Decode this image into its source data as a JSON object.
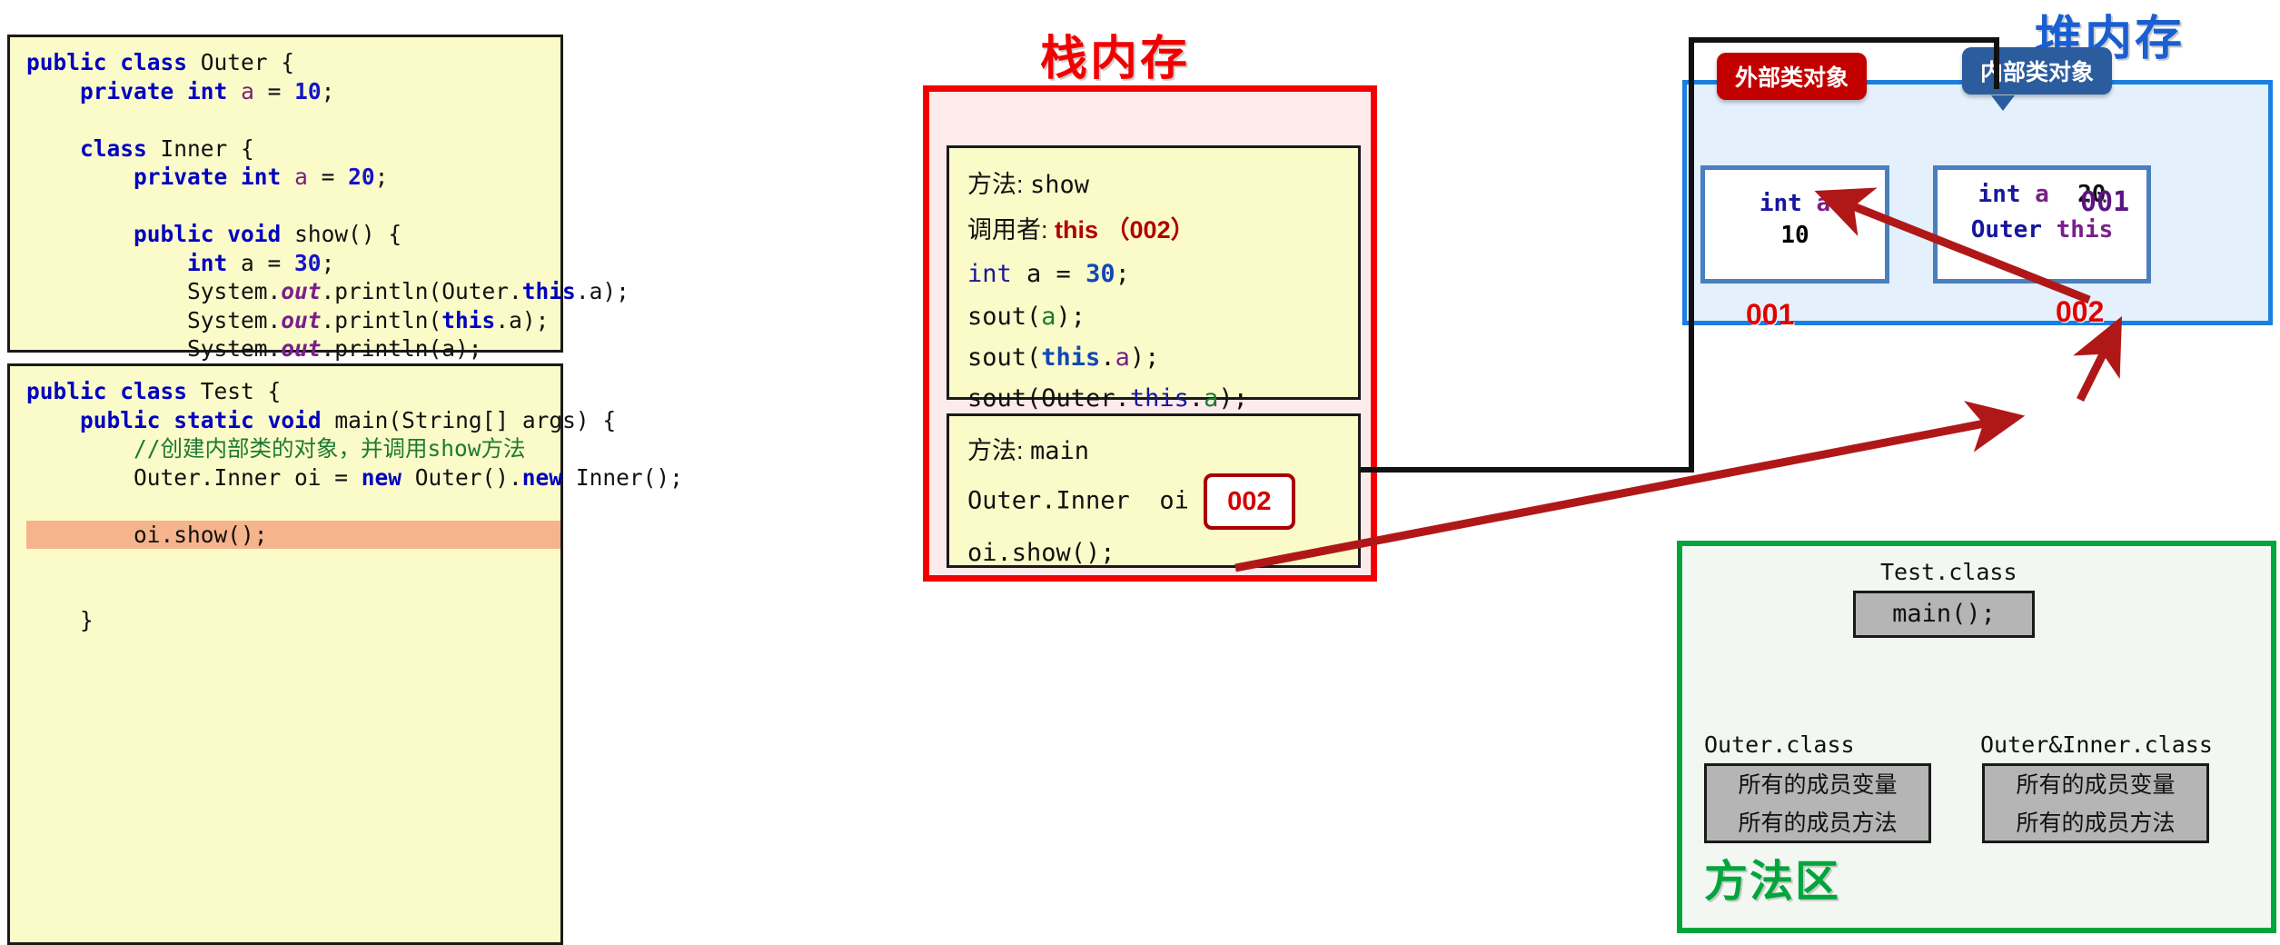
{
  "titles": {
    "stack": "栈内存",
    "heap": "堆内存",
    "method_area": "方法区"
  },
  "code_outer": {
    "lines": [
      "public class Outer {",
      "    private int a = 10;",
      "",
      "    class Inner {",
      "        private int a = 20;",
      "",
      "        public void show() {",
      "            int a = 30;",
      "            System.out.println(Outer.this.a);",
      "            System.out.println(this.a);",
      "            System.out.println(a);",
      "        }",
      "    }",
      "}"
    ]
  },
  "code_test": {
    "lines": [
      "public class Test {",
      "    public static void main(String[] args) {",
      "        //创建内部类的对象，并调用show方法",
      "        Outer.Inner oi = new Outer().new Inner();",
      "",
      "        oi.show();",
      "",
      "",
      "    }"
    ],
    "highlighted_line": "        oi.show();"
  },
  "stack": {
    "frame_show": {
      "method_label": "方法:",
      "method_name": "show",
      "caller_label": "调用者:",
      "caller_value": "this （002）",
      "lines": [
        "int a = 30;",
        "sout(a);",
        "sout(this.a);",
        "sout(Outer.this.a);"
      ]
    },
    "frame_main": {
      "method_label": "方法:",
      "method_name": "main",
      "var_decl": "Outer.Inner  oi",
      "var_value": "002",
      "call_line": "oi.show();"
    }
  },
  "heap": {
    "outer_object": {
      "tag": "外部类对象",
      "field_type": "int",
      "field_name": "a",
      "field_value": "10",
      "address": "001"
    },
    "inner_object": {
      "tag": "内部类对象",
      "field_type": "int",
      "field_name": "a",
      "field_value": "20",
      "ref_type": "Outer",
      "ref_name": "this",
      "ref_value": "001",
      "address": "002"
    }
  },
  "method_area": {
    "test_class": {
      "label": "Test.class",
      "member": "main();"
    },
    "outer_class": {
      "label": "Outer.class",
      "line1": "所有的成员变量",
      "line2": "所有的成员方法"
    },
    "inner_class": {
      "label": "Outer&Inner.class",
      "line1": "所有的成员变量",
      "line2": "所有的成员方法"
    }
  },
  "colors": {
    "stack_red": "#f20000",
    "heap_blue": "#1a7fe0",
    "method_green": "#00a53c",
    "arrow_red": "#b01818",
    "highlight_orange": "#f6b48c",
    "code_bg": "#fbfbc9"
  }
}
